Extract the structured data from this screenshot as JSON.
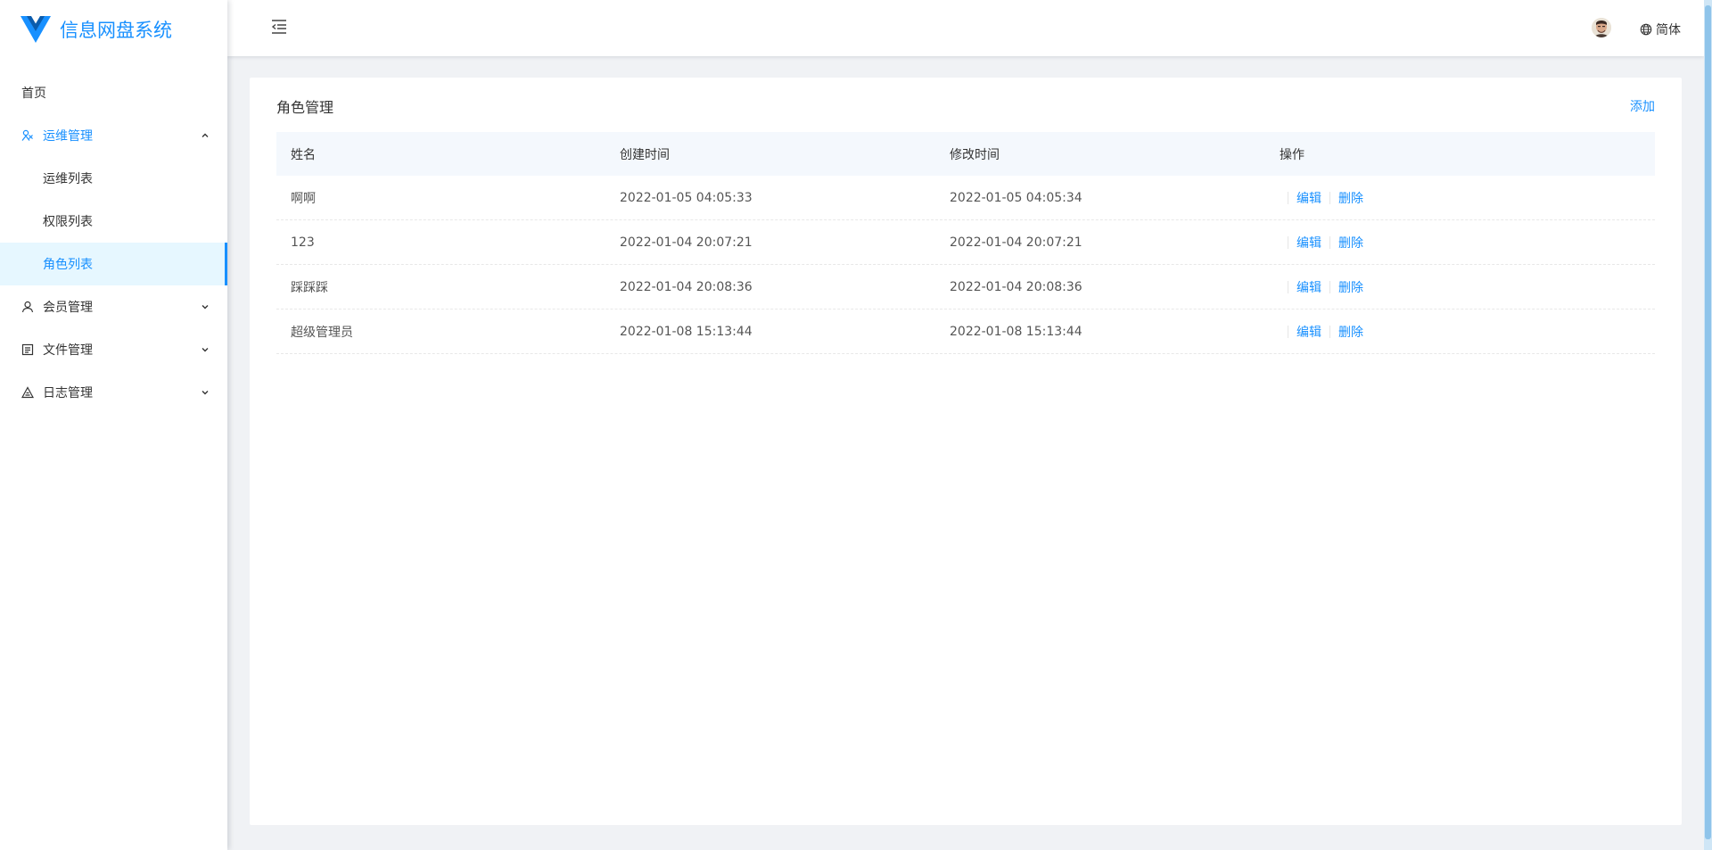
{
  "app": {
    "title": "信息网盘系统"
  },
  "sidebar": {
    "items": [
      {
        "label": "首页"
      },
      {
        "label": "运维管理",
        "children": [
          {
            "label": "运维列表"
          },
          {
            "label": "权限列表"
          },
          {
            "label": "角色列表"
          }
        ]
      },
      {
        "label": "会员管理"
      },
      {
        "label": "文件管理"
      },
      {
        "label": "日志管理"
      }
    ]
  },
  "header": {
    "language": "简体"
  },
  "page": {
    "title": "角色管理",
    "add_label": "添加",
    "columns": [
      "姓名",
      "创建时间",
      "修改时间",
      "操作"
    ],
    "rows": [
      {
        "name": "啊啊",
        "created": "2022-01-05 04:05:33",
        "modified": "2022-01-05 04:05:34"
      },
      {
        "name": "123",
        "created": "2022-01-04 20:07:21",
        "modified": "2022-01-04 20:07:21"
      },
      {
        "name": "踩踩踩",
        "created": "2022-01-04 20:08:36",
        "modified": "2022-01-04 20:08:36"
      },
      {
        "name": "超级管理员",
        "created": "2022-01-08 15:13:44",
        "modified": "2022-01-08 15:13:44"
      }
    ],
    "actions": {
      "edit": "编辑",
      "delete": "删除"
    }
  },
  "colors": {
    "primary": "#1890ff",
    "table_header_bg": "#f4f8fd",
    "selected_bg": "#e6f7ff"
  }
}
